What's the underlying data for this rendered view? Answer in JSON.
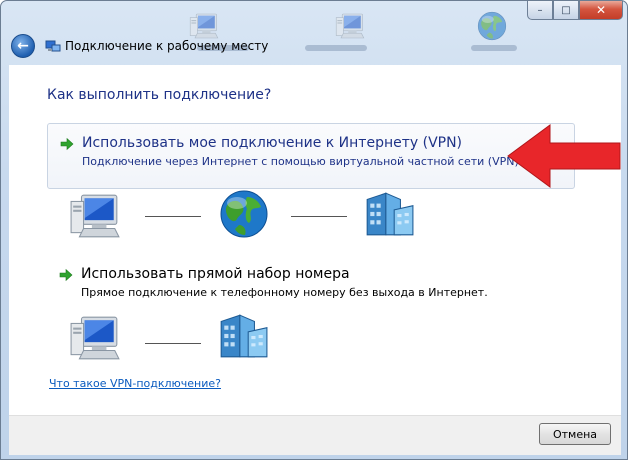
{
  "window": {
    "title": "Подключение к рабочему месту",
    "controls": {
      "minimize": "–",
      "maximize": "□",
      "close": "✕"
    }
  },
  "heading": "Как выполнить подключение?",
  "options": [
    {
      "title": "Использовать мое подключение к Интернету (VPN)",
      "description": "Подключение через Интернет с помощью виртуальной частной сети (VPN).",
      "icon": "green-arrow-icon",
      "diagram": [
        "computer-icon",
        "globe-icon",
        "office-building-icon"
      ]
    },
    {
      "title": "Использовать прямой набор номера",
      "description": "Прямое подключение к телефонному номеру без выхода в Интернет.",
      "icon": "green-arrow-icon",
      "diagram": [
        "computer-icon",
        "office-building-icon"
      ]
    }
  ],
  "help_link": "Что такое VPN-подключение?",
  "footer": {
    "cancel_label": "Отмена"
  },
  "colors": {
    "link_blue": "#1e3287",
    "hyperlink": "#0a5bbf",
    "annotation_arrow": "#e8262a",
    "option_arrow": "#2fa32f"
  }
}
